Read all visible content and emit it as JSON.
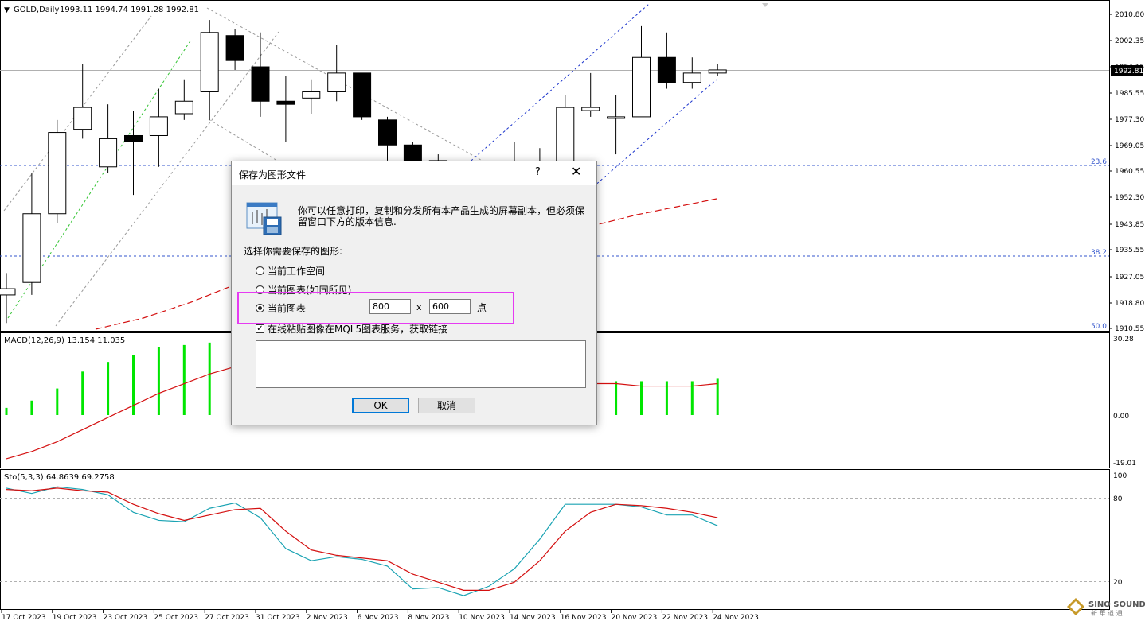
{
  "chart": {
    "symbol_label": "GOLD,Daily",
    "ohlc_label": "1993.11 1994.74 1991.28 1992.81",
    "current_price": "1992.81",
    "price_axis": [
      "2010.80",
      "2002.35",
      "1994.15",
      "1985.55",
      "1977.30",
      "1969.05",
      "1960.55",
      "1952.30",
      "1943.85",
      "1935.55",
      "1927.05",
      "1918.80",
      "1910.55"
    ],
    "fib_levels": [
      "23.6",
      "38.2",
      "50.0"
    ],
    "macd_label": "MACD(12,26,9) 13.154 11.035",
    "macd_axis": [
      "30.28",
      "0.00",
      "-19.01"
    ],
    "stoch_label": "Sto(5,3,3) 64.8639 69.2758",
    "stoch_axis": [
      "100",
      "80",
      "20"
    ],
    "dates": [
      "17 Oct 2023",
      "19 Oct 2023",
      "23 Oct 2023",
      "25 Oct 2023",
      "27 Oct 2023",
      "31 Oct 2023",
      "2 Nov 2023",
      "6 Nov 2023",
      "8 Nov 2023",
      "10 Nov 2023",
      "14 Nov 2023",
      "16 Nov 2023",
      "20 Nov 2023",
      "22 Nov 2023",
      "24 Nov 2023"
    ],
    "watermark": "SINO SOUND",
    "watermark_sub": "新 華 道 通",
    "colors": {
      "bull_fill": "#ffffff",
      "bear_fill": "#000000",
      "macd_hist": "#00e600",
      "signal": "#e00000",
      "stoch_main": "#1aa3b3",
      "stoch_signal": "#e00000",
      "channel_blue": "#1a33cc",
      "fib_line": "#3355cc",
      "highlight": "#e63bf2"
    }
  },
  "chart_data": {
    "type": "candlestick",
    "candles": [
      {
        "o": 1921.0,
        "h": 1928.0,
        "l": 1912.0,
        "c": 1923.0
      },
      {
        "o": 1925.0,
        "h": 1960.0,
        "l": 1921.0,
        "c": 1947.0
      },
      {
        "o": 1947.0,
        "h": 1977.0,
        "l": 1944.0,
        "c": 1973.0
      },
      {
        "o": 1974.0,
        "h": 1995.0,
        "l": 1971.0,
        "c": 1981.0
      },
      {
        "o": 1962.0,
        "h": 1982.0,
        "l": 1960.0,
        "c": 1971.0
      },
      {
        "o": 1972.0,
        "h": 1980.0,
        "l": 1953.0,
        "c": 1970.0
      },
      {
        "o": 1972.0,
        "h": 1987.0,
        "l": 1962.0,
        "c": 1978.0
      },
      {
        "o": 1979.0,
        "h": 1990.0,
        "l": 1977.0,
        "c": 1983.0
      },
      {
        "o": 1986.0,
        "h": 2009.0,
        "l": 1977.0,
        "c": 2005.0
      },
      {
        "o": 2004.0,
        "h": 2006.0,
        "l": 1993.0,
        "c": 1996.0
      },
      {
        "o": 1994.0,
        "h": 2005.0,
        "l": 1978.0,
        "c": 1983.0
      },
      {
        "o": 1983.0,
        "h": 1991.0,
        "l": 1970.0,
        "c": 1982.0
      },
      {
        "o": 1984.0,
        "h": 1990.0,
        "l": 1979.0,
        "c": 1986.0
      },
      {
        "o": 1986.0,
        "h": 2001.0,
        "l": 1983.0,
        "c": 1992.0
      },
      {
        "o": 1992.0,
        "h": 1992.0,
        "l": 1977.0,
        "c": 1978.0
      },
      {
        "o": 1977.0,
        "h": 1978.0,
        "l": 1964.0,
        "c": 1969.0
      },
      {
        "o": 1969.0,
        "h": 1970.0,
        "l": 1955.0,
        "c": 1960.0
      },
      {
        "o": 1964.0,
        "h": 1966.0,
        "l": 1950.0,
        "c": 1956.0
      },
      {
        "o": 1950.0,
        "h": 1960.0,
        "l": 1930.0,
        "c": 1940.0
      },
      {
        "o": 1940.0,
        "h": 1956.0,
        "l": 1935.0,
        "c": 1950.0
      },
      {
        "o": 1948.0,
        "h": 1970.0,
        "l": 1940.0,
        "c": 1960.0
      },
      {
        "o": 1955.0,
        "h": 1968.0,
        "l": 1950.0,
        "c": 1962.0
      },
      {
        "o": 1962.0,
        "h": 1985.0,
        "l": 1955.0,
        "c": 1981.0
      },
      {
        "o": 1980.0,
        "h": 1992.0,
        "l": 1978.0,
        "c": 1981.0
      },
      {
        "o": 1978.0,
        "h": 1985.0,
        "l": 1966.0,
        "c": 1978.0
      },
      {
        "o": 1978.0,
        "h": 2007.0,
        "l": 1978.0,
        "c": 1997.0
      },
      {
        "o": 1997.0,
        "h": 2005.0,
        "l": 1987.0,
        "c": 1989.0
      },
      {
        "o": 1989.0,
        "h": 1997.0,
        "l": 1987.0,
        "c": 1992.0
      },
      {
        "o": 1992.0,
        "h": 1995.0,
        "l": 1991.0,
        "c": 1993.0
      }
    ],
    "price_range": [
      1910.55,
      2012.0
    ],
    "macd_histogram": [
      3,
      6,
      11,
      18,
      22,
      25,
      28,
      29,
      30,
      29,
      27,
      24,
      20,
      16,
      13,
      10,
      9,
      9,
      10,
      11,
      12,
      14,
      14,
      14,
      14,
      14,
      14,
      14,
      15
    ],
    "macd_signal": [
      -18,
      -15,
      -11,
      -6,
      -1,
      4,
      9,
      13,
      17,
      20,
      22,
      23,
      24,
      23,
      22,
      20,
      18,
      16,
      15,
      14,
      13,
      13,
      13,
      13,
      13,
      12,
      12,
      12,
      13
    ],
    "macd_range": [
      -19.01,
      30.28
    ],
    "stoch_main": [
      90,
      86,
      91,
      89,
      85,
      72,
      66,
      65,
      75,
      79,
      68,
      45,
      36,
      39,
      37,
      32,
      15,
      16,
      10,
      17,
      30,
      52,
      78,
      78,
      78,
      76,
      70,
      70,
      62
    ],
    "stoch_signal": [
      89,
      88,
      90,
      88,
      87,
      78,
      71,
      66,
      70,
      74,
      75,
      58,
      44,
      40,
      38,
      36,
      26,
      20,
      14,
      14,
      20,
      36,
      58,
      72,
      78,
      77,
      75,
      72,
      68
    ],
    "stoch_range": [
      0,
      100
    ]
  },
  "dialog": {
    "title": "保存为图形文件",
    "help": "?",
    "close": "✕",
    "info": "你可以任意打印，复制和分发所有本产品生成的屏幕副本，但必须保留窗口下方的版本信息.",
    "choose_label": "选择你需要保存的图形:",
    "options": [
      "当前工作空间",
      "当前图表(如同所见)",
      "当前图表"
    ],
    "selected_option": "当前图表",
    "width": "800",
    "height": "600",
    "x_sep": "x",
    "unit": "点",
    "checkbox_label": "在线粘贴图像在MQL5图表服务，获取链接",
    "checkbox_checked": true,
    "ok": "OK",
    "cancel": "取消"
  }
}
